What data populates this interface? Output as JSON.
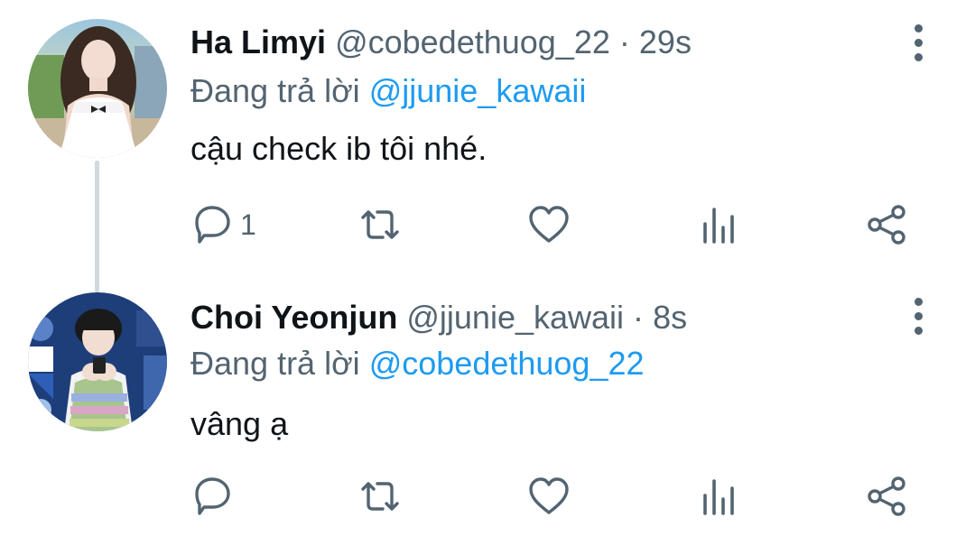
{
  "tweets": [
    {
      "display_name": "Ha Limyi",
      "handle": "@cobedethuog_22",
      "separator": "·",
      "time": "29s",
      "reply_prefix": "Đang trả lời",
      "reply_to": "@jjunie_kawaii",
      "text": "cậu check ib tôi nhé.",
      "reply_count": "1",
      "icons": [
        "reply-icon",
        "retweet-icon",
        "like-icon",
        "views-icon",
        "share-icon",
        "more-options-icon"
      ]
    },
    {
      "display_name": "Choi Yeonjun",
      "handle": "@jjunie_kawaii",
      "separator": "·",
      "time": "8s",
      "reply_prefix": "Đang trả lời",
      "reply_to": "@cobedethuog_22",
      "text": "vâng ạ",
      "reply_count": "",
      "icons": [
        "reply-icon",
        "retweet-icon",
        "like-icon",
        "views-icon",
        "share-icon",
        "more-options-icon"
      ]
    }
  ],
  "colors": {
    "text_primary": "#0f1419",
    "text_secondary": "#536471",
    "mention": "#1d9bf0",
    "thread_line": "#cfd9de",
    "icon": "#536471"
  }
}
